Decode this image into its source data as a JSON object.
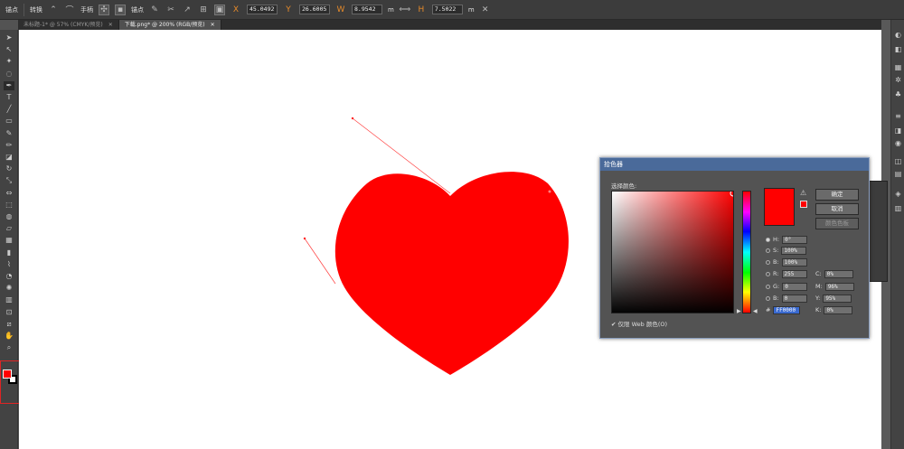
{
  "control_bar": {
    "tool_label": "锚点",
    "convert_label": "转换",
    "handle_label": "手柄",
    "anchor_label": "锚点",
    "x_value": "45.0492",
    "y_value": "26.6005",
    "w_value": "8.9542",
    "w_unit": "m",
    "h_value": "7.5022",
    "h_unit": "m"
  },
  "tabs": [
    {
      "label": "未标题-1* @ 57% (CMYK/预览)",
      "close": "✕"
    },
    {
      "label": "下载.png* @ 200% (RGB/预览)",
      "close": "✕"
    }
  ],
  "toolbar_icons": [
    "selection-icon",
    "direct-selection-icon",
    "magic-wand-icon",
    "lasso-icon",
    "pen-icon",
    "type-icon",
    "line-icon",
    "rectangle-icon",
    "paintbrush-icon",
    "pencil-icon",
    "eraser-icon",
    "rotate-icon",
    "scale-icon",
    "width-icon",
    "free-transform-icon",
    "shape-builder-icon",
    "perspective-icon",
    "mesh-icon",
    "gradient-icon",
    "eyedropper-icon",
    "blend-icon",
    "symbol-sprayer-icon",
    "column-graph-icon",
    "artboard-icon",
    "slice-icon",
    "hand-icon",
    "zoom-icon"
  ],
  "colors": {
    "fill": "#ff0000",
    "heart": "#ff0000",
    "highlight": "#e02424",
    "dialog_title": "#4a6a9a"
  },
  "color_picker": {
    "title": "拾色器",
    "select_color_label": "选择颜色:",
    "ok_label": "确定",
    "cancel_label": "取消",
    "swatches_label": "颜色色板",
    "h_label": "H:",
    "h_value": "0°",
    "s_label": "S:",
    "s_value": "100%",
    "b_label": "B:",
    "b_value": "100%",
    "r_label": "R:",
    "r_value": "255",
    "g_label": "G:",
    "g_value": "0",
    "bb_label": "B:",
    "bb_value": "0",
    "c_label": "C:",
    "c_value": "0%",
    "m_label": "M:",
    "m_value": "96%",
    "y_label": "Y:",
    "y_value": "95%",
    "k_label": "K:",
    "k_value": "0%",
    "hex_label": "#",
    "hex_value": "FF0000",
    "web_only_label": "仅限 Web 颜色(O)",
    "web_only_checked": true
  }
}
